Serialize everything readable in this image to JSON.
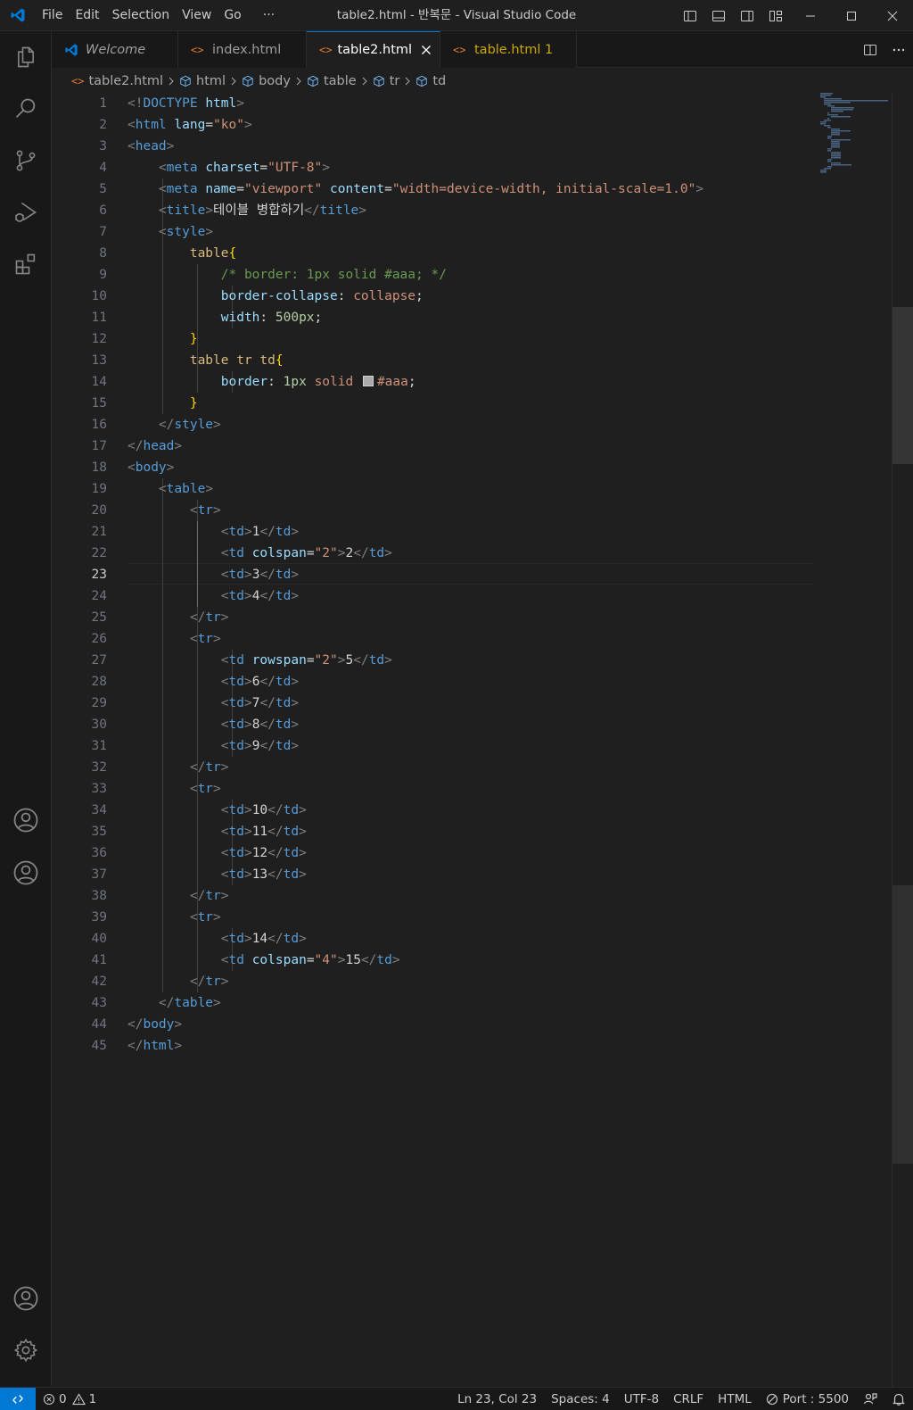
{
  "titlebar": {
    "menu": [
      "File",
      "Edit",
      "Selection",
      "View",
      "Go",
      "···"
    ],
    "title": "table2.html - 반복문 - Visual Studio Code"
  },
  "tabs": [
    {
      "label": "Welcome",
      "icon": "vscode-icon",
      "italic": true
    },
    {
      "label": "index.html",
      "icon": "html-file-icon"
    },
    {
      "label": "table2.html",
      "icon": "html-file-icon",
      "active": true
    },
    {
      "label": "table.html 1",
      "icon": "html-file-icon",
      "warning": true
    }
  ],
  "breadcrumb": [
    "table2.html",
    "html",
    "body",
    "table",
    "tr",
    "td"
  ],
  "editor": {
    "current_line": 23,
    "line_numbers": [
      "1",
      "2",
      "3",
      "4",
      "5",
      "6",
      "7",
      "8",
      "9",
      "10",
      "11",
      "12",
      "13",
      "14",
      "15",
      "16",
      "17",
      "18",
      "19",
      "20",
      "21",
      "22",
      "23",
      "24",
      "25",
      "26",
      "27",
      "28",
      "29",
      "30",
      "31",
      "32",
      "33",
      "34",
      "35",
      "36",
      "37",
      "38",
      "39",
      "40",
      "41",
      "42",
      "43",
      "44",
      "45"
    ],
    "lines": [
      [
        [
          "p",
          "<!"
        ],
        [
          "tag",
          "DOCTYPE"
        ],
        [
          "txt",
          " "
        ],
        [
          "attr",
          "html"
        ],
        [
          "p",
          ">"
        ]
      ],
      [
        [
          "p",
          "<"
        ],
        [
          "tag",
          "html"
        ],
        [
          "txt",
          " "
        ],
        [
          "attr",
          "lang"
        ],
        [
          "txt",
          "="
        ],
        [
          "str",
          "\"ko\""
        ],
        [
          "p",
          ">"
        ]
      ],
      [
        [
          "p",
          "<"
        ],
        [
          "tag",
          "head"
        ],
        [
          "p",
          ">"
        ]
      ],
      [
        [
          "txt",
          "    "
        ],
        [
          "p",
          "<"
        ],
        [
          "tag",
          "meta"
        ],
        [
          "txt",
          " "
        ],
        [
          "attr",
          "charset"
        ],
        [
          "txt",
          "="
        ],
        [
          "str",
          "\"UTF-8\""
        ],
        [
          "p",
          ">"
        ]
      ],
      [
        [
          "txt",
          "    "
        ],
        [
          "p",
          "<"
        ],
        [
          "tag",
          "meta"
        ],
        [
          "txt",
          " "
        ],
        [
          "attr",
          "name"
        ],
        [
          "txt",
          "="
        ],
        [
          "str",
          "\"viewport\""
        ],
        [
          "txt",
          " "
        ],
        [
          "attr",
          "content"
        ],
        [
          "txt",
          "="
        ],
        [
          "str",
          "\"width=device-width, initial-scale=1.0\""
        ],
        [
          "p",
          ">"
        ]
      ],
      [
        [
          "txt",
          "    "
        ],
        [
          "p",
          "<"
        ],
        [
          "tag",
          "title"
        ],
        [
          "p",
          ">"
        ],
        [
          "txt",
          "테이블 병합하기"
        ],
        [
          "p",
          "</"
        ],
        [
          "tag",
          "title"
        ],
        [
          "p",
          ">"
        ]
      ],
      [
        [
          "txt",
          "    "
        ],
        [
          "p",
          "<"
        ],
        [
          "tag",
          "style"
        ],
        [
          "p",
          ">"
        ]
      ],
      [
        [
          "txt",
          "        "
        ],
        [
          "sel",
          "table"
        ],
        [
          "br",
          "{"
        ]
      ],
      [
        [
          "txt",
          "            "
        ],
        [
          "cm",
          "/* border: 1px solid #aaa; */"
        ]
      ],
      [
        [
          "txt",
          "            "
        ],
        [
          "prop",
          "border-collapse"
        ],
        [
          "txt",
          ": "
        ],
        [
          "val",
          "collapse"
        ],
        [
          "txt",
          ";"
        ]
      ],
      [
        [
          "txt",
          "            "
        ],
        [
          "prop",
          "width"
        ],
        [
          "txt",
          ": "
        ],
        [
          "num",
          "500px"
        ],
        [
          "txt",
          ";"
        ]
      ],
      [
        [
          "txt",
          "        "
        ],
        [
          "br",
          "}"
        ]
      ],
      [
        [
          "txt",
          "        "
        ],
        [
          "sel",
          "table tr td"
        ],
        [
          "br",
          "{"
        ]
      ],
      [
        [
          "txt",
          "            "
        ],
        [
          "prop",
          "border"
        ],
        [
          "txt",
          ": "
        ],
        [
          "num",
          "1px"
        ],
        [
          "txt",
          " "
        ],
        [
          "val",
          "solid"
        ],
        [
          "txt",
          " "
        ],
        [
          "swatch",
          ""
        ],
        [
          "val",
          "#aaa"
        ],
        [
          "txt",
          ";"
        ]
      ],
      [
        [
          "txt",
          "        "
        ],
        [
          "br",
          "}"
        ]
      ],
      [
        [
          "txt",
          "    "
        ],
        [
          "p",
          "</"
        ],
        [
          "tag",
          "style"
        ],
        [
          "p",
          ">"
        ]
      ],
      [
        [
          "p",
          "</"
        ],
        [
          "tag",
          "head"
        ],
        [
          "p",
          ">"
        ]
      ],
      [
        [
          "p",
          "<"
        ],
        [
          "tag",
          "body"
        ],
        [
          "p",
          ">"
        ]
      ],
      [
        [
          "txt",
          "    "
        ],
        [
          "p",
          "<"
        ],
        [
          "tag",
          "table"
        ],
        [
          "p",
          ">"
        ]
      ],
      [
        [
          "txt",
          "        "
        ],
        [
          "p",
          "<"
        ],
        [
          "tag",
          "tr"
        ],
        [
          "p",
          ">"
        ]
      ],
      [
        [
          "txt",
          "            "
        ],
        [
          "p",
          "<"
        ],
        [
          "tag",
          "td"
        ],
        [
          "p",
          ">"
        ],
        [
          "txt",
          "1"
        ],
        [
          "p",
          "</"
        ],
        [
          "tag",
          "td"
        ],
        [
          "p",
          ">"
        ]
      ],
      [
        [
          "txt",
          "            "
        ],
        [
          "p",
          "<"
        ],
        [
          "tag",
          "td"
        ],
        [
          "txt",
          " "
        ],
        [
          "attr",
          "colspan"
        ],
        [
          "txt",
          "="
        ],
        [
          "str",
          "\"2\""
        ],
        [
          "p",
          ">"
        ],
        [
          "txt",
          "2"
        ],
        [
          "p",
          "</"
        ],
        [
          "tag",
          "td"
        ],
        [
          "p",
          ">"
        ]
      ],
      [
        [
          "txt",
          "            "
        ],
        [
          "p",
          "<"
        ],
        [
          "tag",
          "td"
        ],
        [
          "p",
          ">"
        ],
        [
          "txt",
          "3"
        ],
        [
          "p",
          "</"
        ],
        [
          "tag",
          "td"
        ],
        [
          "p",
          ">"
        ]
      ],
      [
        [
          "txt",
          "            "
        ],
        [
          "p",
          "<"
        ],
        [
          "tag",
          "td"
        ],
        [
          "p",
          ">"
        ],
        [
          "txt",
          "4"
        ],
        [
          "p",
          "</"
        ],
        [
          "tag",
          "td"
        ],
        [
          "p",
          ">"
        ]
      ],
      [
        [
          "txt",
          "        "
        ],
        [
          "p",
          "</"
        ],
        [
          "tag",
          "tr"
        ],
        [
          "p",
          ">"
        ]
      ],
      [
        [
          "txt",
          "        "
        ],
        [
          "p",
          "<"
        ],
        [
          "tag",
          "tr"
        ],
        [
          "p",
          ">"
        ]
      ],
      [
        [
          "txt",
          "            "
        ],
        [
          "p",
          "<"
        ],
        [
          "tag",
          "td"
        ],
        [
          "txt",
          " "
        ],
        [
          "attr",
          "rowspan"
        ],
        [
          "txt",
          "="
        ],
        [
          "str",
          "\"2\""
        ],
        [
          "p",
          ">"
        ],
        [
          "txt",
          "5"
        ],
        [
          "p",
          "</"
        ],
        [
          "tag",
          "td"
        ],
        [
          "p",
          ">"
        ]
      ],
      [
        [
          "txt",
          "            "
        ],
        [
          "p",
          "<"
        ],
        [
          "tag",
          "td"
        ],
        [
          "p",
          ">"
        ],
        [
          "txt",
          "6"
        ],
        [
          "p",
          "</"
        ],
        [
          "tag",
          "td"
        ],
        [
          "p",
          ">"
        ]
      ],
      [
        [
          "txt",
          "            "
        ],
        [
          "p",
          "<"
        ],
        [
          "tag",
          "td"
        ],
        [
          "p",
          ">"
        ],
        [
          "txt",
          "7"
        ],
        [
          "p",
          "</"
        ],
        [
          "tag",
          "td"
        ],
        [
          "p",
          ">"
        ]
      ],
      [
        [
          "txt",
          "            "
        ],
        [
          "p",
          "<"
        ],
        [
          "tag",
          "td"
        ],
        [
          "p",
          ">"
        ],
        [
          "txt",
          "8"
        ],
        [
          "p",
          "</"
        ],
        [
          "tag",
          "td"
        ],
        [
          "p",
          ">"
        ]
      ],
      [
        [
          "txt",
          "            "
        ],
        [
          "p",
          "<"
        ],
        [
          "tag",
          "td"
        ],
        [
          "p",
          ">"
        ],
        [
          "txt",
          "9"
        ],
        [
          "p",
          "</"
        ],
        [
          "tag",
          "td"
        ],
        [
          "p",
          ">"
        ]
      ],
      [
        [
          "txt",
          "        "
        ],
        [
          "p",
          "</"
        ],
        [
          "tag",
          "tr"
        ],
        [
          "p",
          ">"
        ]
      ],
      [
        [
          "txt",
          "        "
        ],
        [
          "p",
          "<"
        ],
        [
          "tag",
          "tr"
        ],
        [
          "p",
          ">"
        ]
      ],
      [
        [
          "txt",
          "            "
        ],
        [
          "p",
          "<"
        ],
        [
          "tag",
          "td"
        ],
        [
          "p",
          ">"
        ],
        [
          "txt",
          "10"
        ],
        [
          "p",
          "</"
        ],
        [
          "tag",
          "td"
        ],
        [
          "p",
          ">"
        ]
      ],
      [
        [
          "txt",
          "            "
        ],
        [
          "p",
          "<"
        ],
        [
          "tag",
          "td"
        ],
        [
          "p",
          ">"
        ],
        [
          "txt",
          "11"
        ],
        [
          "p",
          "</"
        ],
        [
          "tag",
          "td"
        ],
        [
          "p",
          ">"
        ]
      ],
      [
        [
          "txt",
          "            "
        ],
        [
          "p",
          "<"
        ],
        [
          "tag",
          "td"
        ],
        [
          "p",
          ">"
        ],
        [
          "txt",
          "12"
        ],
        [
          "p",
          "</"
        ],
        [
          "tag",
          "td"
        ],
        [
          "p",
          ">"
        ]
      ],
      [
        [
          "txt",
          "            "
        ],
        [
          "p",
          "<"
        ],
        [
          "tag",
          "td"
        ],
        [
          "p",
          ">"
        ],
        [
          "txt",
          "13"
        ],
        [
          "p",
          "</"
        ],
        [
          "tag",
          "td"
        ],
        [
          "p",
          ">"
        ]
      ],
      [
        [
          "txt",
          "        "
        ],
        [
          "p",
          "</"
        ],
        [
          "tag",
          "tr"
        ],
        [
          "p",
          ">"
        ]
      ],
      [
        [
          "txt",
          "        "
        ],
        [
          "p",
          "<"
        ],
        [
          "tag",
          "tr"
        ],
        [
          "p",
          ">"
        ]
      ],
      [
        [
          "txt",
          "            "
        ],
        [
          "p",
          "<"
        ],
        [
          "tag",
          "td"
        ],
        [
          "p",
          ">"
        ],
        [
          "txt",
          "14"
        ],
        [
          "p",
          "</"
        ],
        [
          "tag",
          "td"
        ],
        [
          "p",
          ">"
        ]
      ],
      [
        [
          "txt",
          "            "
        ],
        [
          "p",
          "<"
        ],
        [
          "tag",
          "td"
        ],
        [
          "txt",
          " "
        ],
        [
          "attr",
          "colspan"
        ],
        [
          "txt",
          "="
        ],
        [
          "str",
          "\"4\""
        ],
        [
          "p",
          ">"
        ],
        [
          "txt",
          "15"
        ],
        [
          "p",
          "</"
        ],
        [
          "tag",
          "td"
        ],
        [
          "p",
          ">"
        ]
      ],
      [
        [
          "txt",
          "        "
        ],
        [
          "p",
          "</"
        ],
        [
          "tag",
          "tr"
        ],
        [
          "p",
          ">"
        ]
      ],
      [
        [
          "txt",
          "    "
        ],
        [
          "p",
          "</"
        ],
        [
          "tag",
          "table"
        ],
        [
          "p",
          ">"
        ]
      ],
      [
        [
          "p",
          "</"
        ],
        [
          "tag",
          "body"
        ],
        [
          "p",
          ">"
        ]
      ],
      [
        [
          "p",
          "</"
        ],
        [
          "tag",
          "html"
        ],
        [
          "p",
          ">"
        ]
      ]
    ]
  },
  "statusbar": {
    "errors": "0",
    "warnings": "1",
    "position": "Ln 23, Col 23",
    "spaces": "Spaces: 4",
    "encoding": "UTF-8",
    "eol": "CRLF",
    "language": "HTML",
    "port": "Port : 5500"
  },
  "colors": {
    "accent": "#0078d4",
    "tag": "#569cd6",
    "attribute": "#9cdcfe",
    "string": "#ce9178",
    "comment": "#6a9955",
    "number": "#b5cea8",
    "selector": "#d7ba7d",
    "bracket": "#ffd700",
    "warning_tab": "#cca700"
  }
}
